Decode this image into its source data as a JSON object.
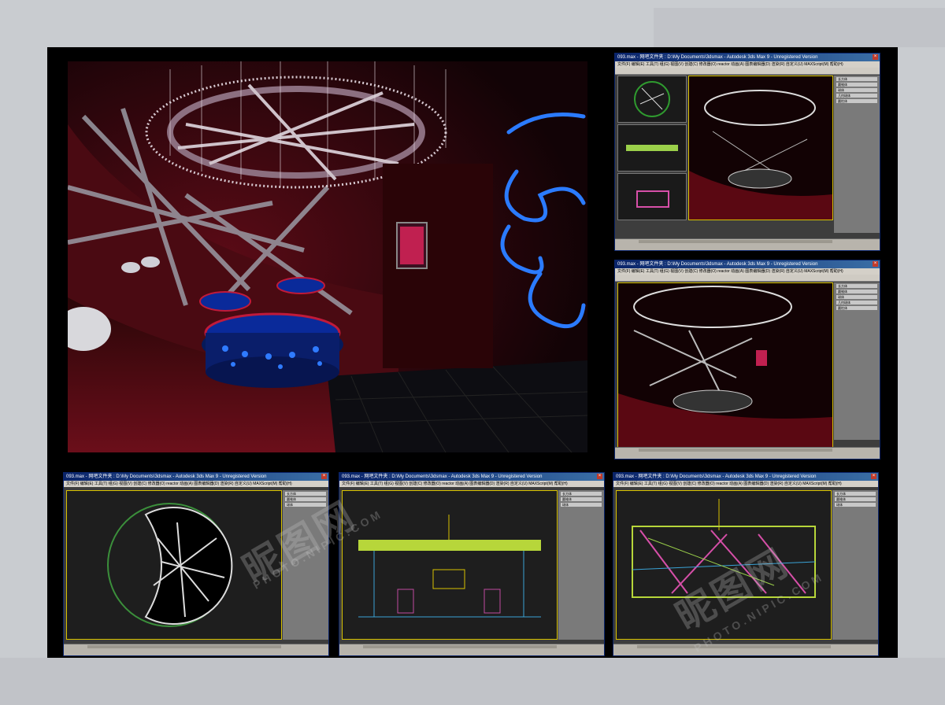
{
  "colors": {
    "accent": "#d8c200",
    "titlebar": "#0a246a",
    "neon_blue": "#1e6bff",
    "neon_red": "#c0122c"
  },
  "windows": [
    {
      "id": "top-right",
      "title": "093.max - 网吧文件夹 : D:\\My Documents\\3dsmax - Autodesk 3ds Max 9 - Unregistered Version",
      "menu": "文件(F)  编辑(E)  工具(T)  组(G)  视图(V)  创建(C)  修改器(O)  reactor  动画(A)  图表编辑器(D)  渲染(R)  自定义(U)  MAXScript(M)  帮助(H)"
    },
    {
      "id": "mid-right",
      "title": "093.max - 网吧文件夹 : D:\\My Documents\\3dsmax - Autodesk 3ds Max 9 - Unregistered Version",
      "menu": "文件(F)  编辑(E)  工具(T)  组(G)  视图(V)  创建(C)  修改器(O)  reactor  动画(A)  图表编辑器(D)  渲染(R)  自定义(U)  MAXScript(M)  帮助(H)"
    },
    {
      "id": "bottom-left",
      "title": "093.max - 网吧文件夹 : D:\\My Documents\\3dsmax - Autodesk 3ds Max 9 - Unregistered Version",
      "menu": "文件(F)  编辑(E)  工具(T)  组(G)  视图(V)  创建(C)  修改器(O)  reactor  动画(A)  图表编辑器(D)  渲染(R)  自定义(U)  MAXScript(M)  帮助(H)"
    },
    {
      "id": "bottom-middle",
      "title": "093.max - 网吧文件夹 : D:\\My Documents\\3dsmax - Autodesk 3ds Max 9 - Unregistered Version",
      "menu": "文件(F)  编辑(E)  工具(T)  组(G)  视图(V)  创建(C)  修改器(O)  reactor  动画(A)  图表编辑器(D)  渲染(R)  自定义(U)  MAXScript(M)  帮助(H)"
    },
    {
      "id": "bottom-right",
      "title": "093.max - 网吧文件夹 : D:\\My Documents\\3dsmax - Autodesk 3ds Max 9 - Unregistered Version",
      "menu": "文件(F)  编辑(E)  工具(T)  组(G)  视图(V)  创建(C)  修改器(O)  reactor  动画(A)  图表编辑器(D)  渲染(R)  自定义(U)  MAXScript(M)  帮助(H)"
    }
  ],
  "cmd_buttons": [
    "长方体",
    "圆锥体",
    "球体",
    "几何球体",
    "圆柱体",
    "管状体",
    "圆环",
    "四棱锥",
    "茶壶",
    "平面"
  ],
  "watermark": {
    "brand": "昵图网",
    "url": "PHOTO.NIPIC.COM"
  }
}
